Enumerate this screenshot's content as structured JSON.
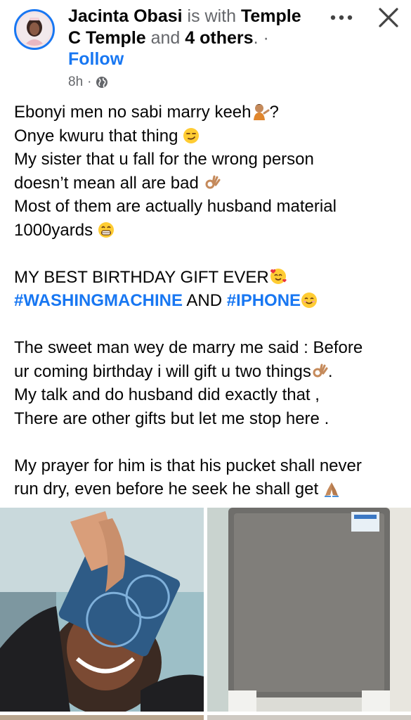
{
  "header": {
    "author": "Jacinta Obasi",
    "with_text": "is with",
    "tagged_line1": "Temple",
    "tagged_line2": "C Temple",
    "and_text": "and",
    "others": "4 others",
    "dot": ". ·",
    "follow_label": "Follow",
    "time": "8h",
    "privacy_icon": "globe-icon",
    "more_icon": "more-horizontal-icon",
    "close_icon": "close-icon"
  },
  "post": {
    "lines": [
      "Ebonyi men no sabi marry keeh",
      "?",
      "Onye kwuru that thing",
      "My sister that u fall for the wrong person",
      "doesn’t mean all are bad",
      "Most of them are actually husband material",
      "1000yards",
      "MY BEST BIRTHDAY GIFT EVER",
      "#WASHINGMACHINE",
      "AND",
      "#IPHONE",
      "The sweet man wey de marry me said : Before",
      "ur coming birthday i will gift u two things",
      ".",
      "My talk and do husband did exactly that ,",
      "There are other gifts but let me stop here .",
      "My prayer for him is  that his pucket shall never",
      "run dry, even before he seek he shall get"
    ]
  },
  "colors": {
    "link": "#1877f2",
    "secondary": "#65676b",
    "text": "#050505"
  }
}
